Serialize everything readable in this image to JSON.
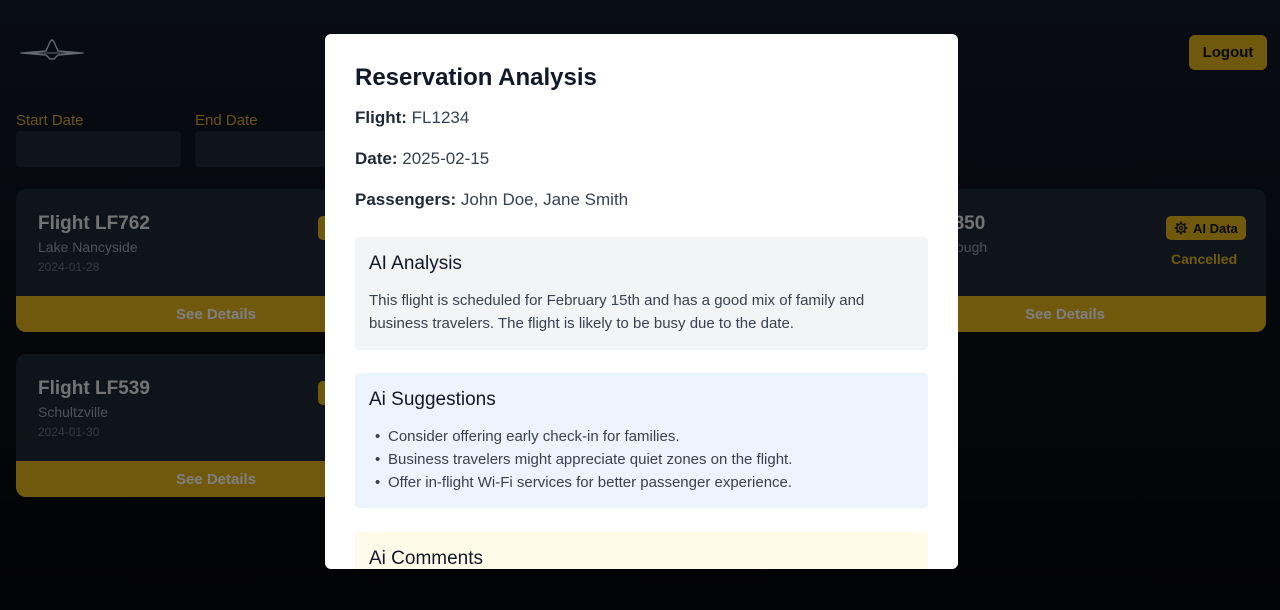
{
  "header": {
    "logout_label": "Logout"
  },
  "filters": {
    "start_label": "Start Date",
    "end_label": "End Date"
  },
  "cards": [
    {
      "title": "Flight LF762",
      "city": "Lake Nancyside",
      "date": "2024-01-28",
      "footer": "See Details"
    },
    {
      "title": "Flight LF539",
      "city": "Schultzville",
      "date": "2024-01-30",
      "footer": "See Details"
    },
    {
      "title": "F850",
      "city": "ough",
      "footer": "See Details",
      "badge": "AI Data",
      "status": "Cancelled"
    }
  ],
  "modal": {
    "title": "Reservation Analysis",
    "flight_label": "Flight:",
    "flight_value": "FL1234",
    "date_label": "Date:",
    "date_value": "2025-02-15",
    "passengers_label": "Passengers:",
    "passengers_value": "John Doe, Jane Smith",
    "analysis": {
      "heading": "AI Analysis",
      "text": "This flight is scheduled for February 15th and has a good mix of family and business travelers. The flight is likely to be busy due to the date."
    },
    "suggestions": {
      "heading": "Ai Suggestions",
      "items": [
        "Consider offering early check-in for families.",
        "Business travelers might appreciate quiet zones on the flight.",
        "Offer in-flight Wi-Fi services for better passenger experience."
      ]
    },
    "comments": {
      "heading": "Ai Comments"
    }
  },
  "colors": {
    "accent": "#e0b31b",
    "analysis_bg": "#f3f4f6",
    "suggestions_bg": "#eef4fd",
    "comments_bg": "#fefbe8"
  }
}
